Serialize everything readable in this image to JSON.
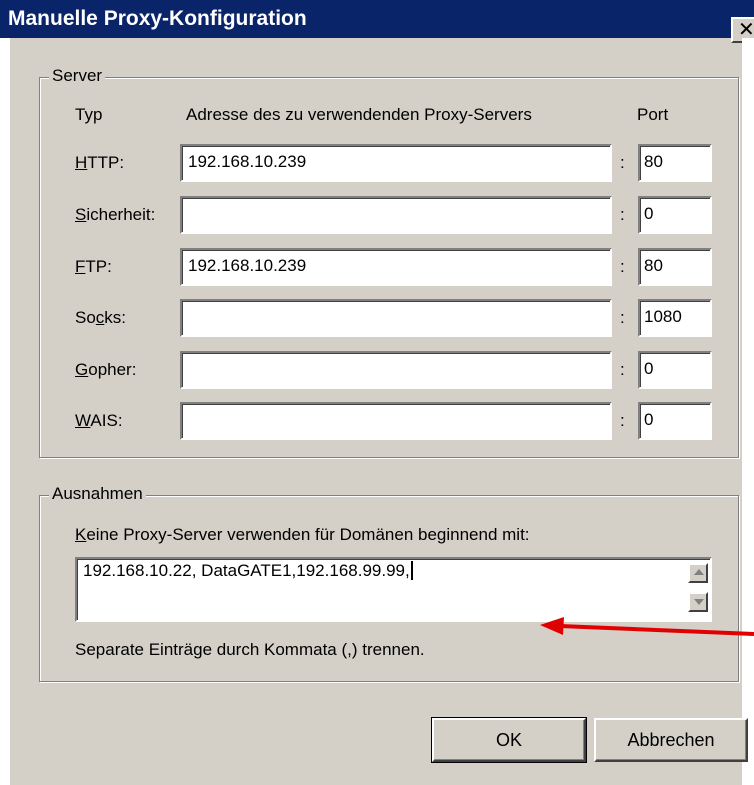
{
  "window": {
    "title": "Manuelle Proxy-Konfiguration",
    "close_glyph": "✕"
  },
  "server": {
    "group_label": "Server",
    "headers": {
      "type": "Typ",
      "address": "Adresse des zu verwendenden Proxy-Servers",
      "port": "Port"
    },
    "rows": [
      {
        "pre": "",
        "accel": "H",
        "post": "TTP:",
        "address": "192.168.10.239",
        "port": "80"
      },
      {
        "pre": "",
        "accel": "S",
        "post": "icherheit:",
        "address": "",
        "port": "0"
      },
      {
        "pre": "",
        "accel": "F",
        "post": "TP:",
        "address": "192.168.10.239",
        "port": "80"
      },
      {
        "pre": "So",
        "accel": "c",
        "post": "ks:",
        "address": "",
        "port": "1080"
      },
      {
        "pre": "",
        "accel": "G",
        "post": "opher:",
        "address": "",
        "port": "0"
      },
      {
        "pre": "",
        "accel": "W",
        "post": "AIS:",
        "address": "",
        "port": "0"
      }
    ],
    "colon": ":"
  },
  "exceptions": {
    "group_label": "Ausnahmen",
    "label_accel": "K",
    "label_rest": "eine Proxy-Server verwenden für Domänen beginnend mit:",
    "value": "192.168.10.22, DataGATE1,192.168.99.99,",
    "hint": "Separate Einträge durch Kommata (,) trennen."
  },
  "buttons": {
    "ok": "OK",
    "cancel": "Abbrechen"
  },
  "annotation": {
    "arrow_color": "#e00000"
  }
}
